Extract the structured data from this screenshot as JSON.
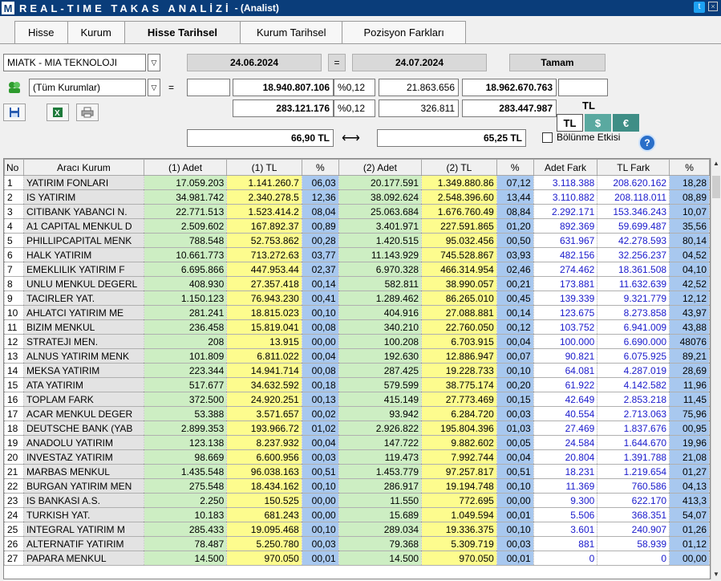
{
  "window": {
    "logo": "M",
    "title": "REAL-TIME TAKAS ANALİZİ",
    "subtitle": "- (Analist)"
  },
  "tabs": [
    "Hisse",
    "Kurum",
    "Hisse Tarihsel",
    "Kurum Tarihsel",
    "Pozisyon Farkları"
  ],
  "toolbar": {
    "stock_select": "MIATK - MIA TEKNOLOJI",
    "start_date": "24.06.2024",
    "equals1": "=",
    "end_date": "24.07.2024",
    "ok_button": "Tamam",
    "institution_select": "(Tüm Kurumlar)",
    "equals2": "=",
    "row1": {
      "v1": "",
      "v2": "18.940.807.106",
      "pct": "%0,12",
      "v3": "21.863.656",
      "v4": "18.962.670.763",
      "v5": ""
    },
    "row2": {
      "v2": "283.121.176",
      "pct": "%0,12",
      "v3": "326.811",
      "v4": "283.447.987"
    },
    "currency_label": "TL",
    "cur_tl": "TL",
    "cur_usd": "$",
    "cur_eur": "€",
    "price1": "66,90 TL",
    "arrow": "⟷",
    "price2": "65,25 TL",
    "split_effect": "Bölünme Etkisi",
    "help": "?"
  },
  "table": {
    "headers": [
      "No",
      "Aracı Kurum",
      "(1) Adet",
      "(1) TL",
      "%",
      "(2) Adet",
      "(2) TL",
      "%",
      "Adet Fark",
      "TL Fark",
      "%"
    ],
    "rows": [
      [
        "1",
        "YATIRIM FONLARI",
        "17.059.203",
        "1.141.260.7",
        "06,03",
        "20.177.591",
        "1.349.880.86",
        "07,12",
        "3.118.388",
        "208.620.162",
        "18,28"
      ],
      [
        "2",
        "IS YATIRIM",
        "34.981.742",
        "2.340.278.5",
        "12,36",
        "38.092.624",
        "2.548.396.60",
        "13,44",
        "3.110.882",
        "208.118.011",
        "08,89"
      ],
      [
        "3",
        "CITIBANK YABANCI N.",
        "22.771.513",
        "1.523.414.2",
        "08,04",
        "25.063.684",
        "1.676.760.49",
        "08,84",
        "2.292.171",
        "153.346.243",
        "10,07"
      ],
      [
        "4",
        "A1 CAPITAL MENKUL D",
        "2.509.602",
        "167.892.37",
        "00,89",
        "3.401.971",
        "227.591.865",
        "01,20",
        "892.369",
        "59.699.487",
        "35,56"
      ],
      [
        "5",
        "PHILLIPCAPITAL MENK",
        "788.548",
        "52.753.862",
        "00,28",
        "1.420.515",
        "95.032.456",
        "00,50",
        "631.967",
        "42.278.593",
        "80,14"
      ],
      [
        "6",
        "HALK YATIRIM",
        "10.661.773",
        "713.272.63",
        "03,77",
        "11.143.929",
        "745.528.867",
        "03,93",
        "482.156",
        "32.256.237",
        "04,52"
      ],
      [
        "7",
        "EMEKLILIK YATIRIM F",
        "6.695.866",
        "447.953.44",
        "02,37",
        "6.970.328",
        "466.314.954",
        "02,46",
        "274.462",
        "18.361.508",
        "04,10"
      ],
      [
        "8",
        "UNLU MENKUL DEGERL",
        "408.930",
        "27.357.418",
        "00,14",
        "582.811",
        "38.990.057",
        "00,21",
        "173.881",
        "11.632.639",
        "42,52"
      ],
      [
        "9",
        "TACIRLER YAT.",
        "1.150.123",
        "76.943.230",
        "00,41",
        "1.289.462",
        "86.265.010",
        "00,45",
        "139.339",
        "9.321.779",
        "12,12"
      ],
      [
        "10",
        "AHLATCI YATIRIM ME",
        "281.241",
        "18.815.023",
        "00,10",
        "404.916",
        "27.088.881",
        "00,14",
        "123.675",
        "8.273.858",
        "43,97"
      ],
      [
        "11",
        "BIZIM MENKUL",
        "236.458",
        "15.819.041",
        "00,08",
        "340.210",
        "22.760.050",
        "00,12",
        "103.752",
        "6.941.009",
        "43,88"
      ],
      [
        "12",
        "STRATEJI MEN.",
        "208",
        "13.915",
        "00,00",
        "100.208",
        "6.703.915",
        "00,04",
        "100.000",
        "6.690.000",
        "48076"
      ],
      [
        "13",
        "ALNUS YATIRIM MENK",
        "101.809",
        "6.811.022",
        "00,04",
        "192.630",
        "12.886.947",
        "00,07",
        "90.821",
        "6.075.925",
        "89,21"
      ],
      [
        "14",
        "MEKSA YATIRIM",
        "223.344",
        "14.941.714",
        "00,08",
        "287.425",
        "19.228.733",
        "00,10",
        "64.081",
        "4.287.019",
        "28,69"
      ],
      [
        "15",
        "ATA YATIRIM",
        "517.677",
        "34.632.592",
        "00,18",
        "579.599",
        "38.775.174",
        "00,20",
        "61.922",
        "4.142.582",
        "11,96"
      ],
      [
        "16",
        "TOPLAM FARK",
        "372.500",
        "24.920.251",
        "00,13",
        "415.149",
        "27.773.469",
        "00,15",
        "42.649",
        "2.853.218",
        "11,45"
      ],
      [
        "17",
        "ACAR MENKUL DEGER",
        "53.388",
        "3.571.657",
        "00,02",
        "93.942",
        "6.284.720",
        "00,03",
        "40.554",
        "2.713.063",
        "75,96"
      ],
      [
        "18",
        "DEUTSCHE BANK (YAB",
        "2.899.353",
        "193.966.72",
        "01,02",
        "2.926.822",
        "195.804.396",
        "01,03",
        "27.469",
        "1.837.676",
        "00,95"
      ],
      [
        "19",
        "ANADOLU YATIRIM",
        "123.138",
        "8.237.932",
        "00,04",
        "147.722",
        "9.882.602",
        "00,05",
        "24.584",
        "1.644.670",
        "19,96"
      ],
      [
        "20",
        "INVESTAZ YATIRIM",
        "98.669",
        "6.600.956",
        "00,03",
        "119.473",
        "7.992.744",
        "00,04",
        "20.804",
        "1.391.788",
        "21,08"
      ],
      [
        "21",
        "MARBAS MENKUL",
        "1.435.548",
        "96.038.163",
        "00,51",
        "1.453.779",
        "97.257.817",
        "00,51",
        "18.231",
        "1.219.654",
        "01,27"
      ],
      [
        "22",
        "BURGAN YATIRIM MEN",
        "275.548",
        "18.434.162",
        "00,10",
        "286.917",
        "19.194.748",
        "00,10",
        "11.369",
        "760.586",
        "04,13"
      ],
      [
        "23",
        "IS BANKASI A.S.",
        "2.250",
        "150.525",
        "00,00",
        "11.550",
        "772.695",
        "00,00",
        "9.300",
        "622.170",
        "413,3"
      ],
      [
        "24",
        "TURKISH YAT.",
        "10.183",
        "681.243",
        "00,00",
        "15.689",
        "1.049.594",
        "00,01",
        "5.506",
        "368.351",
        "54,07"
      ],
      [
        "25",
        "INTEGRAL YATIRIM M",
        "285.433",
        "19.095.468",
        "00,10",
        "289.034",
        "19.336.375",
        "00,10",
        "3.601",
        "240.907",
        "01,26"
      ],
      [
        "26",
        "ALTERNATIF YATIRIM",
        "78.487",
        "5.250.780",
        "00,03",
        "79.368",
        "5.309.719",
        "00,03",
        "881",
        "58.939",
        "01,12"
      ],
      [
        "27",
        "PAPARA MENKUL",
        "14.500",
        "970.050",
        "00,01",
        "14.500",
        "970.050",
        "00,01",
        "0",
        "0",
        "00,00"
      ]
    ]
  },
  "colors": {
    "title_bar": "#0a3d7a",
    "green": "#cdeec3",
    "yellow": "#fdfc8e",
    "blue": "#a8c8ef",
    "fark_text": "#1a1acc",
    "usd_btn": "#5aa9a0",
    "eur_btn": "#3f8e86"
  }
}
